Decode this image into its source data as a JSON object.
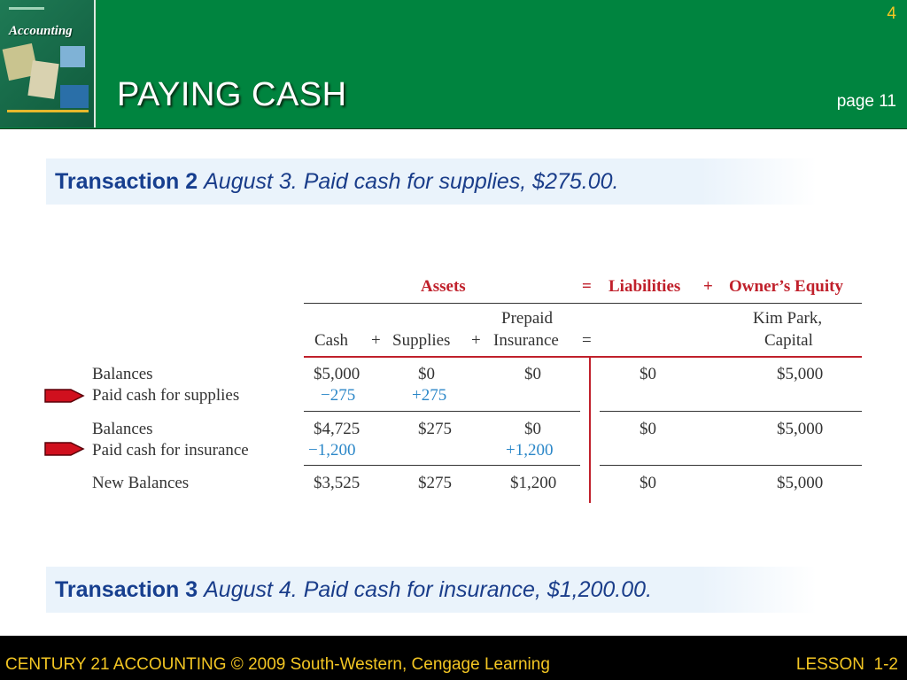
{
  "header": {
    "book_title": "Accounting",
    "slide_number": "4",
    "title": "PAYING CASH",
    "page_ref": "page 11"
  },
  "transaction2": {
    "label": "Transaction 2",
    "text": "August 3. Paid cash for supplies, $275.00."
  },
  "transaction3": {
    "label": "Transaction 3",
    "text": "August 4. Paid cash for insurance, $1,200.00."
  },
  "table": {
    "equation": {
      "assets": "Assets",
      "eq": "=",
      "liabilities": "Liabilities",
      "plus": "+",
      "equity": "Owner’s Equity"
    },
    "columns": {
      "cash": "Cash",
      "plus1": "+",
      "supplies": "Supplies",
      "plus2": "+",
      "prepaid1": "Prepaid",
      "prepaid2": "Insurance",
      "eq": "=",
      "capital1": "Kim Park,",
      "capital2": "Capital"
    },
    "rows": {
      "balances1": "Balances",
      "paid_supplies": "Paid cash for supplies",
      "balances2": "Balances",
      "paid_insurance": "Paid cash for insurance",
      "new_balances": "New Balances"
    },
    "values": {
      "r1": {
        "cash": "$5,000",
        "supplies": "$0",
        "prepaid": "$0",
        "liab": "$0",
        "capital": "$5,000"
      },
      "r2": {
        "cash": "−275",
        "supplies": "+275"
      },
      "r3": {
        "cash": "$4,725",
        "supplies": "$275",
        "prepaid": "$0",
        "liab": "$0",
        "capital": "$5,000"
      },
      "r4": {
        "cash": "−1,200",
        "prepaid": "+1,200"
      },
      "r5": {
        "cash": "$3,525",
        "supplies": "$275",
        "prepaid": "$1,200",
        "liab": "$0",
        "capital": "$5,000"
      }
    }
  },
  "footer": {
    "left": "CENTURY 21 ACCOUNTING © 2009 South-Western, Cengage Learning",
    "right": "LESSON  1-2"
  },
  "colors": {
    "header_green": "#00843f",
    "accent_yellow": "#f3c623",
    "heading_red": "#c0202b",
    "change_blue": "#2b87c8",
    "arrow_red": "#d0101e"
  }
}
